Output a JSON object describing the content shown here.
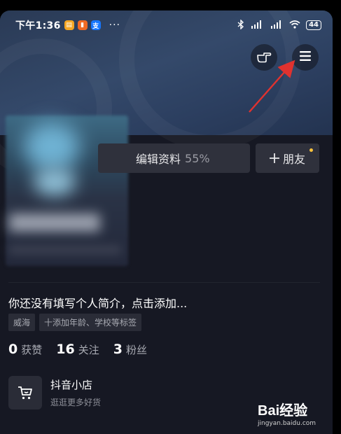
{
  "status_bar": {
    "time": "下午1:36",
    "apps": [
      {
        "name": "note-app-icon",
        "glyph": "▤",
        "color": "#f5a623"
      },
      {
        "name": "book-app-icon",
        "glyph": "▮",
        "color": "#f06a24"
      },
      {
        "name": "alipay-app-icon",
        "glyph": "支",
        "color": "#1677ff"
      }
    ],
    "more": "···",
    "battery": "44"
  },
  "profile": {
    "edit_label": "编辑资料",
    "edit_percent": "55%",
    "friend_label": "朋友",
    "bio": "你还没有填写个人简介，点击添加...",
    "tags": [
      "威海",
      "十添加年龄、学校等标签"
    ]
  },
  "stats": [
    {
      "num": "0",
      "label": "获赞"
    },
    {
      "num": "16",
      "label": "关注"
    },
    {
      "num": "3",
      "label": "粉丝"
    }
  ],
  "shop": {
    "title": "抖音小店",
    "subtitle": "逛逛更多好货"
  },
  "watermark": {
    "logo": "Bai经验",
    "url": "jingyan.baidu.com"
  },
  "colors": {
    "background": "#161823",
    "accent_arrow": "#e0322f",
    "notification_dot": "#f9c23c"
  }
}
